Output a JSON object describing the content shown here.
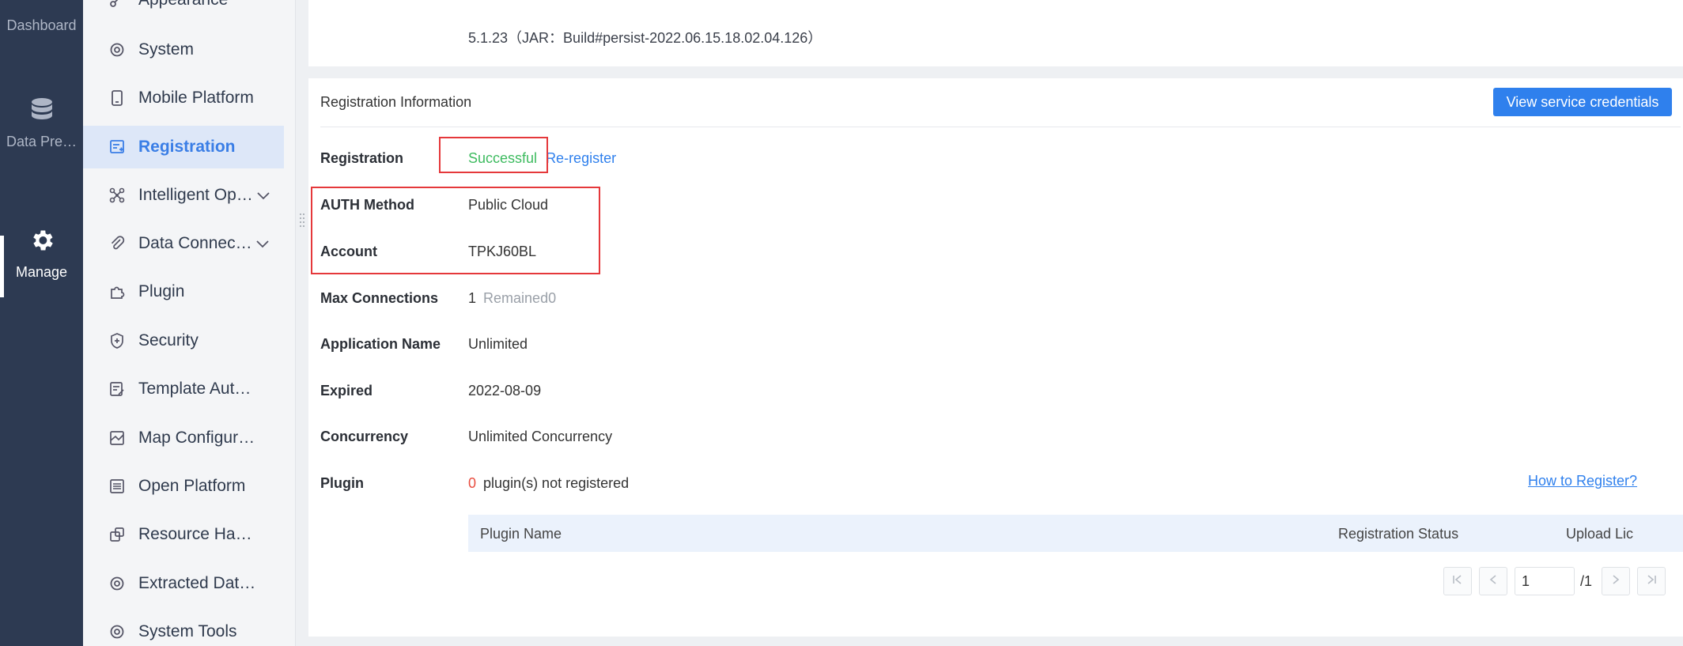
{
  "rail": {
    "dashboard": "Dashboard",
    "data_prep": "Data Pre…",
    "manage": "Manage"
  },
  "sidebar": {
    "items": [
      {
        "label": "Appearance"
      },
      {
        "label": "System"
      },
      {
        "label": "Mobile Platform"
      },
      {
        "label": "Registration"
      },
      {
        "label": "Intelligent Op…"
      },
      {
        "label": "Data Connec…"
      },
      {
        "label": "Plugin"
      },
      {
        "label": "Security"
      },
      {
        "label": "Template Authent…"
      },
      {
        "label": "Map Configuration"
      },
      {
        "label": "Open Platform"
      },
      {
        "label": "Resource Hando…"
      },
      {
        "label": "Extracted Data C…"
      },
      {
        "label": "System Tools"
      }
    ]
  },
  "version_text": "5.1.23（JAR：Build#persist-2022.06.15.18.02.04.126）",
  "registration": {
    "section_title": "Registration Information",
    "view_credentials_button": "View service credentials",
    "rows": {
      "registration": {
        "label": "Registration",
        "status": "Successful",
        "action": "Re-register"
      },
      "auth": {
        "label": "AUTH Method",
        "value": "Public Cloud"
      },
      "account": {
        "label": "Account",
        "value": "TPKJ60BL"
      },
      "max_conn": {
        "label": "Max Connections",
        "value": "1",
        "remained": "Remained0"
      },
      "app_name": {
        "label": "Application Name",
        "value": "Unlimited"
      },
      "expired": {
        "label": "Expired",
        "value": "2022-08-09"
      },
      "concurrency": {
        "label": "Concurrency",
        "value": "Unlimited Concurrency"
      },
      "plugin": {
        "label": "Plugin",
        "count": "0",
        "text": "plugin(s) not registered"
      }
    },
    "how_to_register": "How to Register?",
    "table_headers": {
      "plugin_name": "Plugin Name",
      "status": "Registration Status",
      "upload": "Upload Lic"
    },
    "pager": {
      "page": "1",
      "total": "/1"
    }
  },
  "colors": {
    "primary": "#2f80ed",
    "success": "#3dbb5f",
    "danger": "#e94d3f",
    "highlight_box": "#e5383b",
    "rail_bg": "#2d3a52"
  }
}
